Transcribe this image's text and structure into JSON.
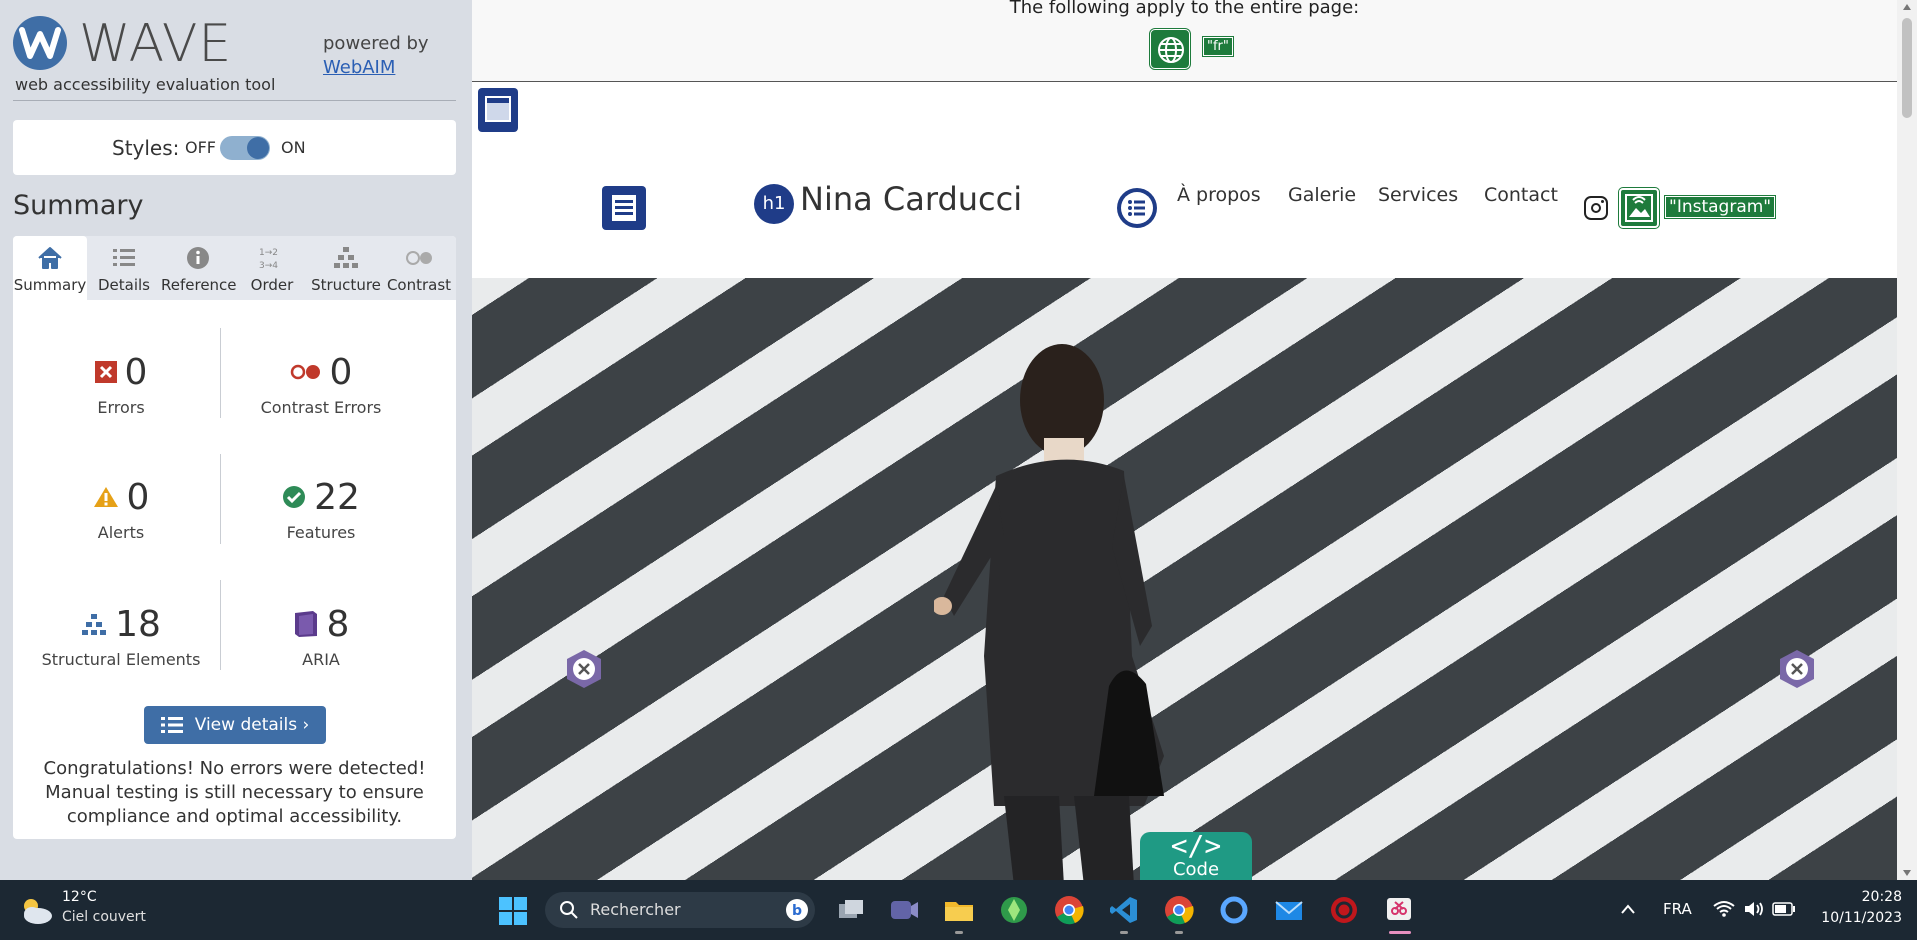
{
  "wave": {
    "title": "WAVE",
    "tagline": "web accessibility evaluation tool",
    "powered_by": "powered by",
    "webaim_link": "WebAIM",
    "styles_label": "Styles:",
    "styles_off": "OFF",
    "styles_on": "ON",
    "summary_heading": "Summary",
    "tabs": [
      {
        "label": "Summary",
        "icon": "home-icon",
        "active": true
      },
      {
        "label": "Details",
        "icon": "list-icon"
      },
      {
        "label": "Reference",
        "icon": "info-icon"
      },
      {
        "label": "Order",
        "icon": "order-icon"
      },
      {
        "label": "Structure",
        "icon": "structure-icon"
      },
      {
        "label": "Contrast",
        "icon": "contrast-icon"
      }
    ],
    "stats": {
      "errors": {
        "value": "0",
        "label": "Errors"
      },
      "contrast_errors": {
        "value": "0",
        "label": "Contrast Errors"
      },
      "alerts": {
        "value": "0",
        "label": "Alerts"
      },
      "features": {
        "value": "22",
        "label": "Features"
      },
      "structural": {
        "value": "18",
        "label": "Structural Elements"
      },
      "aria": {
        "value": "8",
        "label": "ARIA"
      }
    },
    "view_details": "View details ›",
    "congrats": "Congratulations! No errors were detected! Manual testing is still necessary to ensure compliance and optimal accessibility."
  },
  "page": {
    "note": "The following apply to the entire page:",
    "lang_code": "\"fr\"",
    "site_title": "Nina Carducci",
    "h1_badge": "h1",
    "nav": [
      "À propos",
      "Galerie",
      "Services",
      "Contact"
    ],
    "instagram_alt": "\"Instagram\"",
    "code_sym": "</>",
    "code_label": "Code"
  },
  "taskbar": {
    "temp": "12°C",
    "weather": "Ciel couvert",
    "search_placeholder": "Rechercher",
    "lang": "FRA",
    "time": "20:28",
    "date": "10/11/2023"
  },
  "colors": {
    "wave_blue": "#3f6ea6",
    "error_red": "#c0392b",
    "feature_green": "#2e8b57",
    "alert_orange": "#e6a117",
    "aria_purple": "#5b3b8c",
    "wave_green": "#1e7b3c",
    "structure_navy": "#1f3c88"
  }
}
